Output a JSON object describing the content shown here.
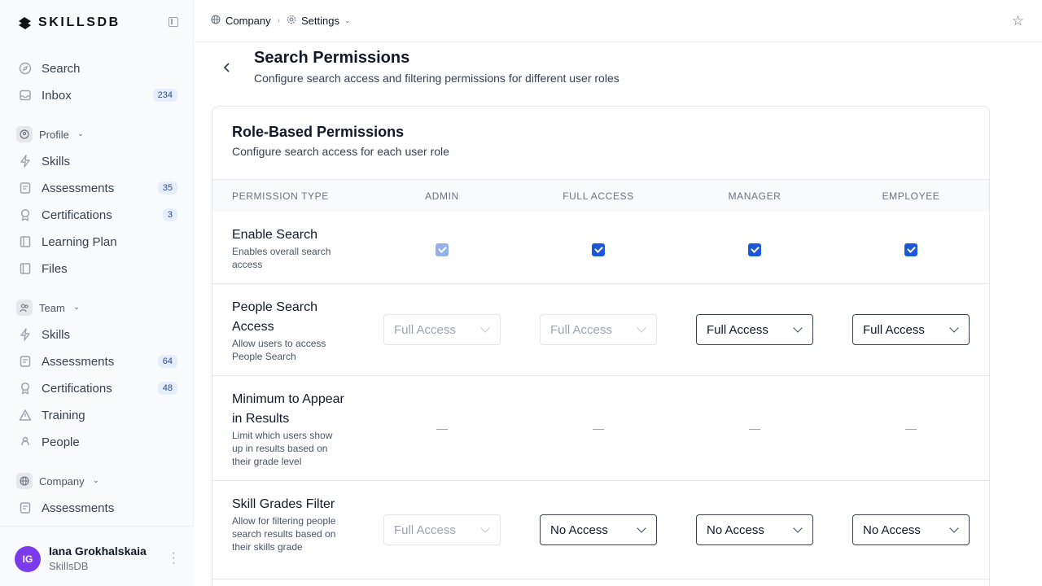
{
  "brand": {
    "name": "SKILLSDB"
  },
  "sidebar": {
    "top_items": [
      {
        "label": "Search",
        "icon": "compass-icon"
      },
      {
        "label": "Inbox",
        "icon": "inbox-icon",
        "badge": "234"
      }
    ],
    "profile_section": {
      "label": "Profile",
      "items": [
        {
          "label": "Skills",
          "icon": "bolt-icon"
        },
        {
          "label": "Assessments",
          "icon": "clipboard-icon",
          "badge": "35"
        },
        {
          "label": "Certifications",
          "icon": "award-icon",
          "badge": "3"
        },
        {
          "label": "Learning Plan",
          "icon": "book-icon"
        },
        {
          "label": "Files",
          "icon": "file-icon"
        }
      ]
    },
    "team_section": {
      "label": "Team",
      "items": [
        {
          "label": "Skills",
          "icon": "bolt-icon"
        },
        {
          "label": "Assessments",
          "icon": "clipboard-icon",
          "badge": "64"
        },
        {
          "label": "Certifications",
          "icon": "award-icon",
          "badge": "48"
        },
        {
          "label": "Training",
          "icon": "triangle-icon"
        },
        {
          "label": "People",
          "icon": "people-icon"
        }
      ]
    },
    "company_section": {
      "label": "Company",
      "items": [
        {
          "label": "Assessments",
          "icon": "clipboard-icon"
        }
      ]
    },
    "user": {
      "initials": "IG",
      "name": "Iana Grokhalskaia",
      "org": "SkillsDB"
    }
  },
  "breadcrumb": {
    "company": "Company",
    "settings": "Settings"
  },
  "header": {
    "title": "Search Permissions",
    "subtitle": "Configure search access and filtering permissions for different user roles"
  },
  "card": {
    "title": "Role-Based Permissions",
    "subtitle": "Configure search access for each user role",
    "columns": {
      "type": "PERMISSION TYPE",
      "admin": "ADMIN",
      "full": "FULL ACCESS",
      "manager": "MANAGER",
      "employee": "EMPLOYEE"
    },
    "rows": {
      "enable": {
        "title": "Enable Search",
        "desc": "Enables overall search access"
      },
      "people": {
        "title": "People Search Access",
        "desc": "Allow users to access People Search",
        "admin": "Full Access",
        "full": "Full Access",
        "manager": "Full Access",
        "employee": "Full Access"
      },
      "minimum": {
        "title": "Minimum to Appear in Results",
        "desc": "Limit which users show up in results based on their grade level"
      },
      "grades": {
        "title": "Skill Grades Filter",
        "desc": "Allow for filtering people search results based on their skills grade",
        "admin": "Full Access",
        "full": "No Access",
        "manager": "No Access",
        "employee": "No Access"
      }
    }
  }
}
